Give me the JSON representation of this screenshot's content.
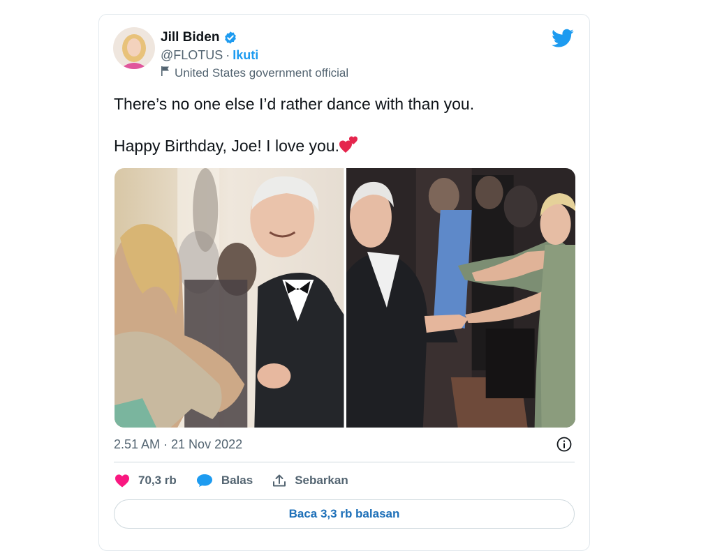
{
  "author": {
    "name": "Jill Biden",
    "handle": "@FLOTUS",
    "separator": "·",
    "follow_label": "Ikuti",
    "account_label": "United States government official"
  },
  "tweet": {
    "line1": "There’s no one else I’d rather dance with than you.",
    "line2": "Happy Birthday, Joe! I love you."
  },
  "timestamp": "2.51 AM · 21 Nov 2022",
  "actions": {
    "likes": "70,3 rb",
    "reply_label": "Balas",
    "share_label": "Sebarkan"
  },
  "read_replies_label": "Baca 3,3 rb balasan",
  "colors": {
    "accent": "#1d9bf0",
    "like": "#f91880",
    "text": "#0f1419",
    "secondary": "#536471"
  },
  "icons": [
    "verified-badge-icon",
    "twitter-bird-icon",
    "flag-icon",
    "heart-icon",
    "reply-bubble-icon",
    "share-icon",
    "info-icon"
  ]
}
